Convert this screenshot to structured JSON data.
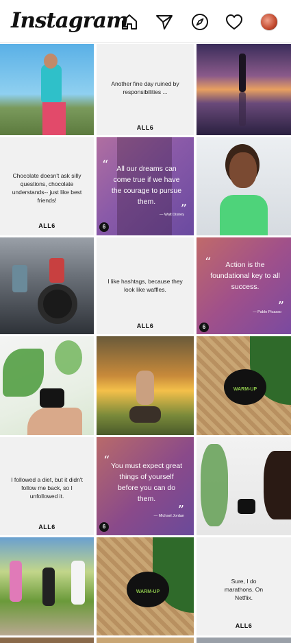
{
  "header": {
    "logo": "Instagram",
    "icons": [
      "home-icon",
      "direct-icon",
      "explore-icon",
      "heart-icon",
      "profile-avatar"
    ]
  },
  "brand": "ALL6",
  "tiles": {
    "t2": "Another fine day ruined by responsibilities ...",
    "t4": "Chocolate doesn't ask silly questions, chocolate understands-- just like best friends!",
    "t5": "All our dreams can come true if we have the courage to pursue them.",
    "t5_author": "— Walt Disney",
    "t8": "I like hashtags, because they look like waffles.",
    "t9": "Action is the foundational key to all success.",
    "t9_author": "— Pablo Picasso",
    "t12_label": "WARM-UP",
    "t13": "I followed a diet, but it didn't follow me back, so I unfollowed it.",
    "t14": "You must expect great things of yourself before you can do them.",
    "t14_author": "— Michael Jordan",
    "t17_label": "WARM-UP",
    "t18": "Sure, I do marathons. On Netflix."
  },
  "colors": {
    "bg": "#ffffff",
    "accent_green": "#8bc34a"
  }
}
